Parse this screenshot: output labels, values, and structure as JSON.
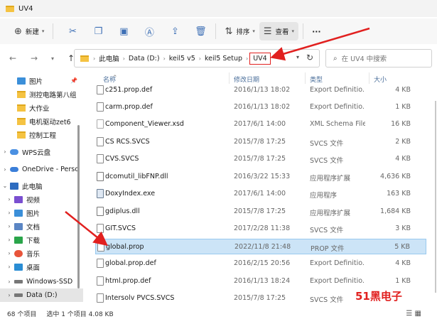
{
  "window": {
    "title": "UV4"
  },
  "toolbar": {
    "new_label": "新建",
    "sort_label": "排序",
    "view_label": "查看",
    "more_label": "···"
  },
  "address": {
    "crumbs": [
      "此电脑",
      "Data (D:)",
      "keil5 v5",
      "keil5 Setup",
      "UV4"
    ],
    "search_placeholder": "在 UV4 中搜索"
  },
  "sidebar": {
    "items": [
      {
        "label": "图片",
        "icon": "picture-icon"
      },
      {
        "label": "测控电路第八组",
        "icon": "folder-icon"
      },
      {
        "label": "大作业",
        "icon": "folder-icon"
      },
      {
        "label": "电机驱动zet6",
        "icon": "folder-icon"
      },
      {
        "label": "控制工程",
        "icon": "folder-icon"
      },
      {
        "label": "WPS云盘",
        "icon": "wps-cloud-icon"
      },
      {
        "label": "OneDrive - Perso",
        "icon": "onedrive-icon"
      },
      {
        "label": "此电脑",
        "icon": "computer-icon"
      },
      {
        "label": "视频",
        "icon": "video-icon"
      },
      {
        "label": "图片",
        "icon": "picture-icon"
      },
      {
        "label": "文档",
        "icon": "document-icon"
      },
      {
        "label": "下载",
        "icon": "download-icon"
      },
      {
        "label": "音乐",
        "icon": "music-icon"
      },
      {
        "label": "桌面",
        "icon": "desktop-icon"
      },
      {
        "label": "Windows-SSD",
        "icon": "drive-icon"
      },
      {
        "label": "Data (D:)",
        "icon": "drive-icon"
      }
    ]
  },
  "columns": {
    "name": "名称",
    "date": "修改日期",
    "type": "类型",
    "size": "大小"
  },
  "files": [
    {
      "name": "c251.prop.def",
      "date": "2016/1/13 18:02",
      "type": "Export Definitio...",
      "size": "4 KB"
    },
    {
      "name": "carm.prop.def",
      "date": "2016/1/13 18:02",
      "type": "Export Definitio...",
      "size": "1 KB"
    },
    {
      "name": "Component_Viewer.xsd",
      "date": "2017/6/1 14:00",
      "type": "XML Schema File",
      "size": "16 KB"
    },
    {
      "name": "CS RCS.SVCS",
      "date": "2015/7/8 17:25",
      "type": "SVCS 文件",
      "size": "2 KB"
    },
    {
      "name": "CVS.SVCS",
      "date": "2015/7/8 17:25",
      "type": "SVCS 文件",
      "size": "4 KB"
    },
    {
      "name": "dcomutil_libFNP.dll",
      "date": "2016/3/22 15:33",
      "type": "应用程序扩展",
      "size": "4,636 KB"
    },
    {
      "name": "DoxyIndex.exe",
      "date": "2017/6/1 14:00",
      "type": "应用程序",
      "size": "163 KB"
    },
    {
      "name": "gdiplus.dll",
      "date": "2015/7/8 17:25",
      "type": "应用程序扩展",
      "size": "1,684 KB"
    },
    {
      "name": "GIT.SVCS",
      "date": "2017/2/28 11:38",
      "type": "SVCS 文件",
      "size": "3 KB"
    },
    {
      "name": "global.prop",
      "date": "2022/11/8 21:48",
      "type": "PROP 文件",
      "size": "5 KB"
    },
    {
      "name": "global.prop.def",
      "date": "2016/2/15 20:56",
      "type": "Export Definitio...",
      "size": "4 KB"
    },
    {
      "name": "html.prop.def",
      "date": "2016/1/13 18:24",
      "type": "Export Definitio...",
      "size": "1 KB"
    },
    {
      "name": "Intersolv PVCS.SVCS",
      "date": "2015/7/8 17:25",
      "type": "SVCS 文件",
      "size": ""
    }
  ],
  "status": {
    "count": "68 个项目",
    "selection": "选中 1 个项目  4.08 KB"
  },
  "watermark": "51黑电子"
}
